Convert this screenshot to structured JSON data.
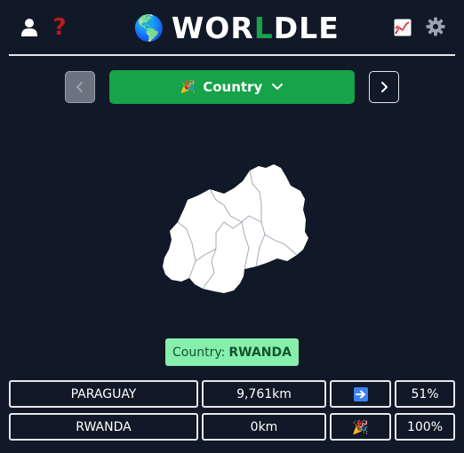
{
  "header": {
    "logo_globe": "🌎",
    "title_part1": "WOR",
    "title_highlight": "L",
    "title_part2": "DLE",
    "help_symbol": "?",
    "icons": [
      "user-icon",
      "help-icon",
      "stats-icon",
      "gear-icon"
    ]
  },
  "mode": {
    "emoji": "🎉",
    "label": "Country"
  },
  "answer": {
    "prefix": "Country:",
    "value": "RWANDA"
  },
  "guesses": [
    {
      "name": "PARAGUAY",
      "distance": "9,761km",
      "direction": "➡️",
      "proximity": "51%"
    },
    {
      "name": "RWANDA",
      "distance": "0km",
      "direction": "🎉",
      "proximity": "100%"
    }
  ],
  "colors": {
    "background": "#111827",
    "accent": "#16a34a",
    "answer_bg": "#86efac",
    "help": "#b91c1c"
  }
}
